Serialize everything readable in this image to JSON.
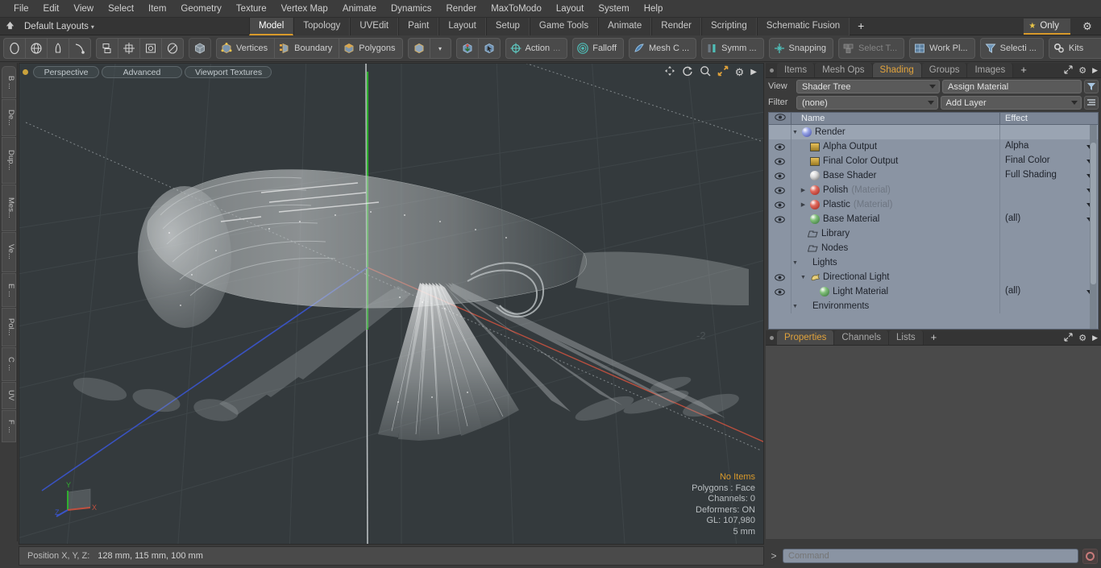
{
  "app": {
    "title": "Modo 3D Modeling Application"
  },
  "menubar": {
    "items": [
      "File",
      "Edit",
      "View",
      "Select",
      "Item",
      "Geometry",
      "Texture",
      "Vertex Map",
      "Animate",
      "Dynamics",
      "Render",
      "MaxToModo",
      "Layout",
      "System",
      "Help"
    ]
  },
  "layoutbar": {
    "home_icon": "home-icon",
    "layout_selector": "Default Layouts",
    "caret": "▾",
    "tabs": [
      {
        "label": "Model",
        "active": true
      },
      {
        "label": "Topology",
        "active": false
      },
      {
        "label": "UVEdit",
        "active": false
      },
      {
        "label": "Paint",
        "active": false
      },
      {
        "label": "Layout",
        "active": false
      },
      {
        "label": "Setup",
        "active": false
      },
      {
        "label": "Game Tools",
        "active": false
      },
      {
        "label": "Animate",
        "active": false
      },
      {
        "label": "Render",
        "active": false
      },
      {
        "label": "Scripting",
        "active": false
      },
      {
        "label": "Schematic Fusion",
        "active": false
      }
    ],
    "add_tab": "+",
    "only_button": "Only",
    "star_icon": "star-icon",
    "gear_icon": "gear-icon",
    "accent_color": "#d99a2b"
  },
  "toolbar": {
    "shape_tools": [
      "ellipse-tool",
      "globe-tool",
      "pen-tool",
      "curve-tool"
    ],
    "arrange_tools": [
      "align-tool",
      "center-tool",
      "frame-tool",
      "oval-tool"
    ],
    "cube_button": "cube-icon",
    "selection_modes": [
      {
        "label": "Vertices",
        "icon": "vertices-icon"
      },
      {
        "label": "Boundary",
        "icon": "boundary-icon"
      },
      {
        "label": "Polygons",
        "icon": "polygons-icon"
      }
    ],
    "item_mode_icon": "item-mode-icon",
    "item_dropdown": "▾",
    "falloff_icons": [
      "element-move-icon",
      "element-select-icon"
    ],
    "action_center": "Action",
    "action_ellipsis": "...",
    "falloff": "Falloff",
    "mesh_constraint": "Mesh C ...",
    "symmetry": "Symm ...",
    "snapping": "Snapping",
    "select_through": "Select T...",
    "work_plane": "Work Pl...",
    "selection_sets": "Selecti ...",
    "kits": "Kits",
    "app_badge_1": "modo-badge-icon",
    "app_badge_2": "unreal-badge-icon"
  },
  "left_tabs": [
    "B ...",
    "De...",
    "Dup...",
    "Mes...",
    "Ve...",
    "E ...",
    "Pol...",
    "C ...",
    "UV",
    "F ..."
  ],
  "viewport": {
    "active_dot": "viewport-active-dot",
    "pills": [
      "Perspective",
      "Advanced",
      "Viewport Textures"
    ],
    "tools": [
      "move-view-icon",
      "rotate-view-icon",
      "zoom-view-icon",
      "fit-view-icon",
      "viewport-gear-icon",
      "viewport-more-icon"
    ],
    "background_color": "#343a3d",
    "axis_colors": {
      "x": "#b44b4b",
      "y": "#39b339",
      "z": "#3f52c8"
    },
    "info": {
      "items_status": "No Items",
      "polygons": "Polygons : Face",
      "channels": "Channels: 0",
      "deformers": "Deformers: ON",
      "gl": "GL: 107,980",
      "grid": "5 mm"
    },
    "gizmo": {
      "x_label": "X",
      "y_label": "Y",
      "z_label": "Z"
    }
  },
  "shader_panel": {
    "tabs": [
      {
        "label": "Items",
        "active": false
      },
      {
        "label": "Mesh Ops",
        "active": false
      },
      {
        "label": "Shading",
        "active": true
      },
      {
        "label": "Groups",
        "active": false
      },
      {
        "label": "Images",
        "active": false
      }
    ],
    "add_tab": "+",
    "expand_icon": "expand-icon",
    "gear_icon": "gear-icon",
    "more_icon": "chevron-right-icon",
    "view_label": "View",
    "view_value": "Shader Tree",
    "assign_material": "Assign Material",
    "filter_label": "Filter",
    "filter_value": "(none)",
    "add_layer": "Add Layer",
    "filter_icon": "filter-icon",
    "list_icon": "list-options-icon",
    "columns": {
      "eye": "eye-icon",
      "name": "Name",
      "effect": "Effect"
    },
    "rows": [
      {
        "name": "Render",
        "suffix": "",
        "effect": "",
        "indent": 0,
        "eye": false,
        "twirl": "down",
        "icon": "sphere-blue",
        "selected": true,
        "has_dropdown": false
      },
      {
        "name": "Alpha Output",
        "suffix": "",
        "effect": "Alpha",
        "indent": 1,
        "eye": true,
        "twirl": "leaf",
        "icon": "image",
        "selected": false,
        "has_dropdown": true
      },
      {
        "name": "Final Color Output",
        "suffix": "",
        "effect": "Final Color",
        "indent": 1,
        "eye": true,
        "twirl": "leaf",
        "icon": "image",
        "selected": false,
        "has_dropdown": true
      },
      {
        "name": "Base Shader",
        "suffix": "",
        "effect": "Full Shading",
        "indent": 1,
        "eye": true,
        "twirl": "leaf",
        "icon": "sphere-gray",
        "selected": false,
        "has_dropdown": true
      },
      {
        "name": "Polish",
        "suffix": "(Material)",
        "effect": "",
        "indent": 1,
        "eye": true,
        "twirl": "right",
        "icon": "sphere-red",
        "selected": false,
        "has_dropdown": true
      },
      {
        "name": "Plastic",
        "suffix": "(Material)",
        "effect": "",
        "indent": 1,
        "eye": true,
        "twirl": "right",
        "icon": "sphere-red",
        "selected": false,
        "has_dropdown": true
      },
      {
        "name": "Base Material",
        "suffix": "",
        "effect": "(all)",
        "indent": 1,
        "eye": true,
        "twirl": "leaf",
        "icon": "sphere-green",
        "selected": false,
        "has_dropdown": true
      },
      {
        "name": "Library",
        "suffix": "",
        "effect": "",
        "indent": 1,
        "eye": false,
        "twirl": "none",
        "icon": "folder",
        "selected": false,
        "has_dropdown": false
      },
      {
        "name": "Nodes",
        "suffix": "",
        "effect": "",
        "indent": 1,
        "eye": false,
        "twirl": "none",
        "icon": "folder",
        "selected": false,
        "has_dropdown": false
      },
      {
        "name": "Lights",
        "suffix": "",
        "effect": "",
        "indent": 0,
        "eye": false,
        "twirl": "down",
        "icon": "none",
        "selected": false,
        "has_dropdown": false
      },
      {
        "name": "Directional Light",
        "suffix": "",
        "effect": "",
        "indent": 1,
        "eye": true,
        "twirl": "down",
        "icon": "light",
        "selected": false,
        "has_dropdown": false
      },
      {
        "name": "Light Material",
        "suffix": "",
        "effect": "(all)",
        "indent": 2,
        "eye": true,
        "twirl": "leaf",
        "icon": "sphere-green",
        "selected": false,
        "has_dropdown": true
      },
      {
        "name": "Environments",
        "suffix": "",
        "effect": "",
        "indent": 0,
        "eye": false,
        "twirl": "down",
        "icon": "none",
        "selected": false,
        "has_dropdown": false
      }
    ]
  },
  "properties_panel": {
    "tabs": [
      {
        "label": "Properties",
        "active": true
      },
      {
        "label": "Channels",
        "active": false
      },
      {
        "label": "Lists",
        "active": false
      }
    ],
    "add_tab": "+",
    "expand_icon": "expand-icon",
    "gear_icon": "gear-icon",
    "more_icon": "chevron-right-icon"
  },
  "statusbar": {
    "position_label": "Position X, Y, Z:",
    "position_value": "128 mm, 115 mm, 100 mm"
  },
  "command_bar": {
    "prompt": ">",
    "placeholder": "Command",
    "value": "",
    "record_icon": "record-circle-icon"
  }
}
